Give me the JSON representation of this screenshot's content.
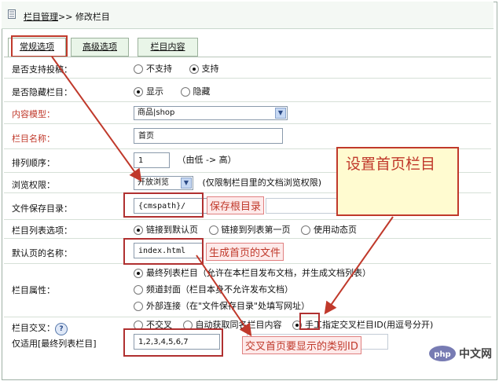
{
  "breadcrumb": {
    "parent": "栏目管理",
    "separator": ">>",
    "current": "修改栏目"
  },
  "tabs": [
    {
      "label": "常规选项",
      "active": true
    },
    {
      "label": "高级选项",
      "active": false
    },
    {
      "label": "栏目内容",
      "active": false
    }
  ],
  "form": {
    "allow_submit": {
      "label": "是否支持投稿：",
      "opt1": "不支持",
      "opt2": "支持",
      "selected": "支持"
    },
    "hide_column": {
      "label": "是否隐藏栏目：",
      "opt1": "显示",
      "opt2": "隐藏",
      "selected": "显示"
    },
    "content_model": {
      "label": "内容模型：",
      "value": "商品|shop"
    },
    "column_name": {
      "label": "栏目名称：",
      "value": "首页"
    },
    "sort_order": {
      "label": "排列顺序：",
      "value": "1",
      "hint": "（由低 -> 高）"
    },
    "browse_perm": {
      "label": "浏览权限：",
      "value": "开放浏览",
      "hint": "(仅限制栏目里的文档浏览权限)"
    },
    "save_dir": {
      "label": "文件保存目录：",
      "value": "{cmspath}/"
    },
    "list_option": {
      "label": "栏目列表选项：",
      "opt1": "链接到默认页",
      "opt2": "链接到列表第一页",
      "opt3": "使用动态页",
      "selected": "链接到默认页"
    },
    "default_page": {
      "label": "默认页的名称：",
      "value": "index.html"
    },
    "column_attr": {
      "label": "栏目属性：",
      "opt1": "最终列表栏目（允许在本栏目发布文档，并生成文档列表）",
      "opt2": "频道封面（栏目本身不允许发布文档）",
      "opt3": "外部连接（在\"文件保存目录\"处填写网址）",
      "selected": "最终列表栏目"
    },
    "cross": {
      "label": "栏目交叉：",
      "opt1": "不交叉",
      "opt2": "自动获取同名栏目内容",
      "opt3": "手工指定交叉栏目ID(用逗号分开)",
      "selected": "手工指定交叉栏目ID"
    },
    "cross_ids": {
      "label": "仅适用[最终列表栏目]",
      "value": "1,2,3,4,5,6,7"
    }
  },
  "annotations": {
    "save_root": "保存根目录",
    "gen_home": "生成首页的文件",
    "cross_ids_note": "交叉首页要显示的类别ID",
    "callout": "设置首页栏目"
  },
  "watermark": {
    "text": "中文网",
    "logo": "php"
  },
  "colors": {
    "annotation_red": "#c0392b",
    "tab_green": "#e9f5e8",
    "callout_bg": "#fffbd0"
  }
}
